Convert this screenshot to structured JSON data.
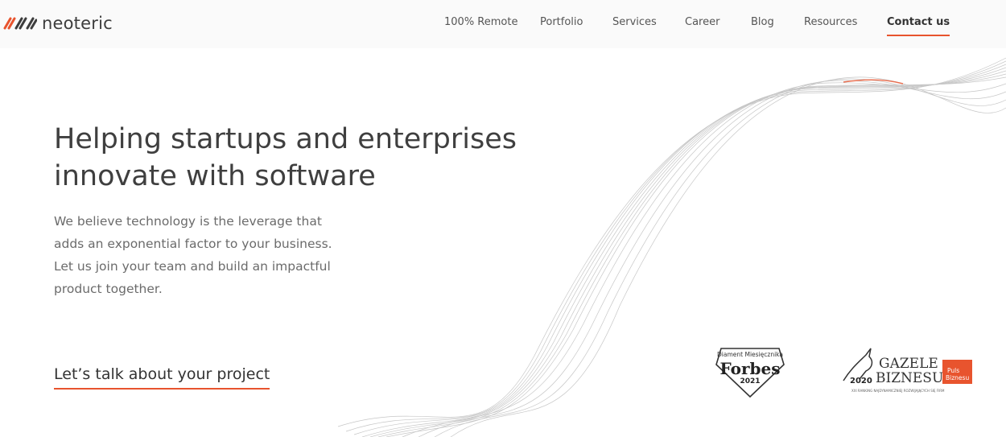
{
  "header": {
    "logo_text": "neoteric",
    "nav": [
      {
        "label": "100% Remote"
      },
      {
        "label": "Portfolio"
      },
      {
        "label": "Services"
      },
      {
        "label": "Career"
      },
      {
        "label": "Blog"
      },
      {
        "label": "Resources"
      },
      {
        "label": "Contact us"
      }
    ]
  },
  "hero": {
    "title_line1": "Helping startups and enterprises",
    "title_line2": "innovate with software",
    "description": "We believe technology is the leverage that adds an exponential factor to your business. Let us join your team and build an impactful product together.",
    "cta": "Let’s talk about your project"
  },
  "badges": {
    "forbes": {
      "top": "Diament Miesięcznika",
      "name": "Forbes",
      "year": "2021"
    },
    "gazele": {
      "line1": "GAZELE",
      "line2": "BIZNESU",
      "year": "2020",
      "tag_line1": "Puls",
      "tag_line2": "Biznesu",
      "fine_print": "XXI RANKING NAJDYNAMICZNIEJ ROZWIJAJĄCYCH SIĘ FIRM"
    }
  },
  "colors": {
    "accent": "#e8542e",
    "text": "#3f3f3f",
    "muted": "#6b6b6b"
  }
}
